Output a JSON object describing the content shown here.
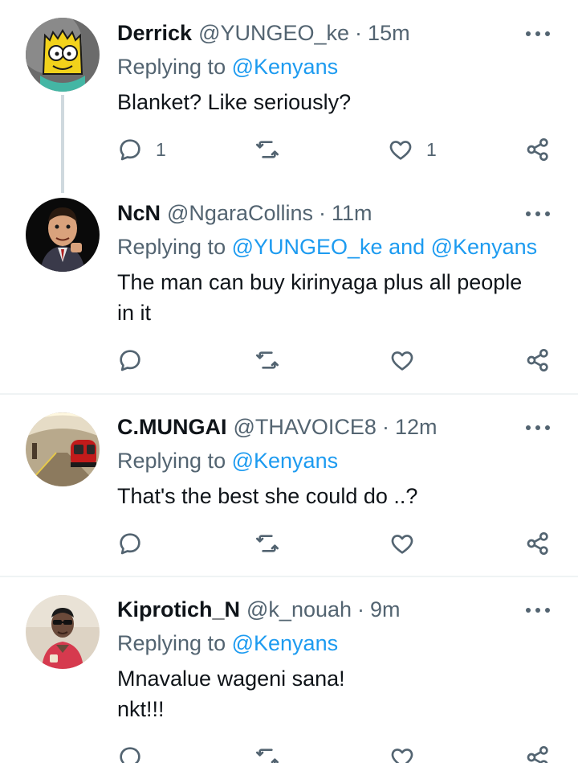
{
  "colors": {
    "accent": "#1d9bf0",
    "text": "#0f1419",
    "muted": "#536471",
    "divider": "#eff3f4"
  },
  "tweets": [
    {
      "name": "Derrick",
      "handle": "@YUNGEO_ke",
      "time": "15m",
      "replying_prefix": "Replying to",
      "mentions": "@Kenyans",
      "body": [
        "Blanket? Like seriously?"
      ],
      "reply_count": "1",
      "like_count": "1",
      "avatar_icon": "cartoon-avatar"
    },
    {
      "name": "NcN",
      "handle": "@NgaraCollins",
      "time": "11m",
      "replying_prefix": "Replying to",
      "mentions": "@YUNGEO_ke and @Kenyans",
      "body": [
        "The man can buy kirinyaga plus all people",
        "in it"
      ],
      "reply_count": "",
      "like_count": "",
      "avatar_icon": "caricature-avatar"
    },
    {
      "name": "C.MUNGAI",
      "handle": "@THAVOICE8",
      "time": "12m",
      "replying_prefix": "Replying to",
      "mentions": "@Kenyans",
      "body": [
        "That's the best she could do ..?"
      ],
      "reply_count": "",
      "like_count": "",
      "avatar_icon": "train-station-avatar"
    },
    {
      "name": "Kiprotich_N",
      "handle": "@k_nouah",
      "time": "9m",
      "replying_prefix": "Replying to",
      "mentions": "@Kenyans",
      "body": [
        "Mnavalue wageni sana!",
        "nkt!!!"
      ],
      "reply_count": "",
      "like_count": "",
      "avatar_icon": "person-photo-avatar"
    }
  ],
  "sep": "·"
}
